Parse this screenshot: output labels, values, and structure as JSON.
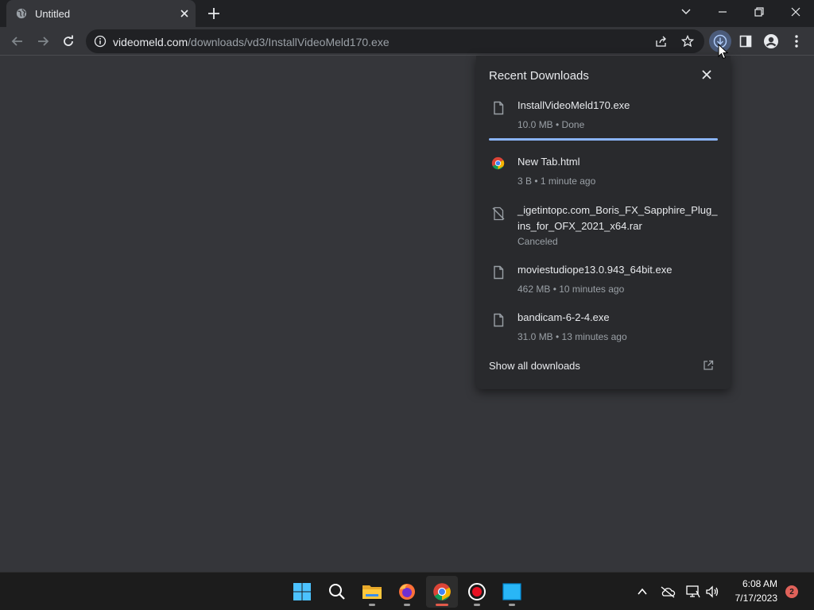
{
  "tab": {
    "title": "Untitled",
    "favicon": "globe-icon"
  },
  "toolbar": {
    "url_host": "videomeld.com",
    "url_path": "/downloads/vd3/InstallVideoMeld170.exe"
  },
  "downloads": {
    "title": "Recent Downloads",
    "items": [
      {
        "name": "InstallVideoMeld170.exe",
        "status": "10.0 MB • Done",
        "icon": "file-icon",
        "progress": 1.0
      },
      {
        "name": "New Tab.html",
        "status": "3 B • 1 minute ago",
        "icon": "chrome-icon"
      },
      {
        "name": "_igetintopc.com_Boris_FX_Sapphire_Plug_ins_for_OFX_2021_x64.rar",
        "status": "Canceled",
        "icon": "file-canceled-icon"
      },
      {
        "name": "moviestudiope13.0.943_64bit.exe",
        "status": "462 MB • 10 minutes ago",
        "icon": "file-icon"
      },
      {
        "name": "bandicam-6-2-4.exe",
        "status": "31.0 MB • 13 minutes ago",
        "icon": "file-icon"
      }
    ],
    "show_all": "Show all downloads"
  },
  "taskbar": {
    "time": "6:08 AM",
    "date": "7/17/2023",
    "notifications": "2",
    "apps": [
      "start-icon",
      "search-icon",
      "file-explorer-icon",
      "firefox-icon",
      "chrome-icon",
      "recorder-icon",
      "window-app-icon"
    ]
  },
  "colors": {
    "page_bg": "#35363a",
    "tabstrip_bg": "#202124",
    "bubble_bg": "#292a2d",
    "accent_blue": "#8ab4f8",
    "taskbar_bg": "#1c1c1c"
  }
}
